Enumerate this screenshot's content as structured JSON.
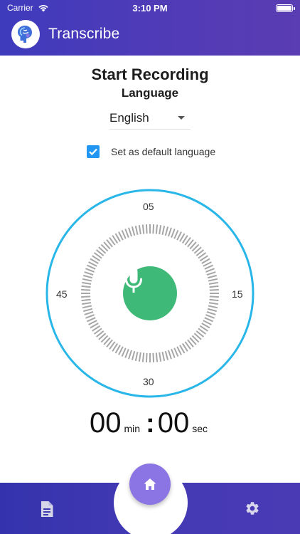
{
  "status_bar": {
    "carrier": "Carrier",
    "time": "3:10 PM"
  },
  "app": {
    "title": "Transcribe"
  },
  "page": {
    "title": "Start Recording",
    "subtitle": "Language"
  },
  "language": {
    "selected": "English",
    "default_label": "Set as default language",
    "default_checked": true
  },
  "dial": {
    "top": "05",
    "right": "15",
    "bottom": "30",
    "left": "45"
  },
  "timer": {
    "minutes": "00",
    "min_unit": "min",
    "separator": ":",
    "seconds": "00",
    "sec_unit": "sec"
  },
  "nav": {
    "left_icon": "document-icon",
    "center_icon": "home-icon",
    "right_icon": "gear-icon"
  },
  "colors": {
    "header": "#3e3bbd",
    "dial_ring": "#29b6e8",
    "mic_button": "#3fb978",
    "checkbox": "#2196f3",
    "home_button": "#8b74e3",
    "bottom_bar": "#3433ad"
  }
}
